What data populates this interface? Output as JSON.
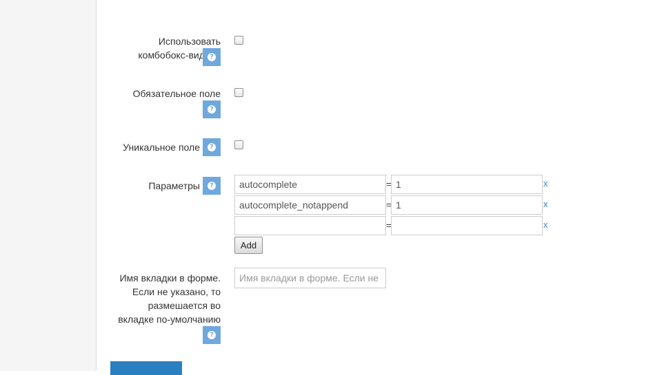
{
  "form": {
    "fields": [
      {
        "label": "Использовать комбобокс-виджет",
        "checked": false
      },
      {
        "label": "Обязательное поле",
        "checked": false
      },
      {
        "label": "Уникальное поле",
        "checked": false
      }
    ],
    "params": {
      "label": "Параметры",
      "rows": [
        {
          "key": "autocomplete",
          "value": "1"
        },
        {
          "key": "autocomplete_notappend",
          "value": "1"
        },
        {
          "key": "",
          "value": ""
        }
      ],
      "eq_symbol": "=",
      "remove_symbol": "x",
      "add_label": "Add"
    },
    "tab_name": {
      "label_lines": [
        "Имя вкладки в форме.",
        "Если не указано, то",
        "размешается во",
        "вкладке по-умолчанию"
      ],
      "placeholder": "Имя вкладки в форме. Если не"
    },
    "help_symbol": "?"
  },
  "colors": {
    "help_bg": "#6fa8dc",
    "submit_bg": "#2a7fc0",
    "link": "#3a87c8"
  }
}
